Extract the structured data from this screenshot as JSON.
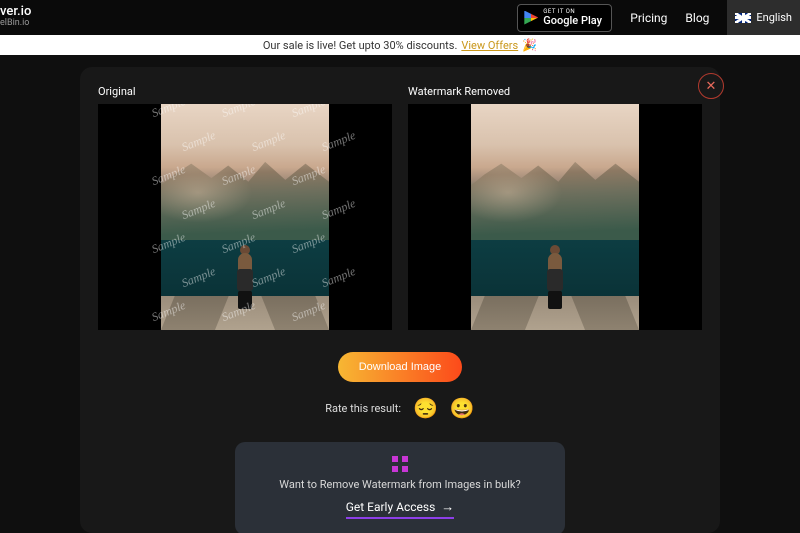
{
  "header": {
    "brand_line1": "ver.io",
    "brand_line2": "elBin.io",
    "google_play_small": "GET IT ON",
    "google_play_large": "Google Play",
    "nav_pricing": "Pricing",
    "nav_blog": "Blog",
    "lang_label": "English"
  },
  "promo": {
    "text": "Our sale is live! Get upto 30% discounts.",
    "link": "View Offers",
    "emoji": "🎉"
  },
  "compare": {
    "original_label": "Original",
    "removed_label": "Watermark Removed",
    "watermark_word": "Sample"
  },
  "actions": {
    "download": "Download Image",
    "rate_label": "Rate this result:",
    "sad": "😔",
    "happy": "😀"
  },
  "bulk": {
    "question": "Want to Remove Watermark from Images in bulk?",
    "cta": "Get Early Access",
    "arrow": "→"
  },
  "colors": {
    "accent_gradient_start": "#f7b733",
    "accent_gradient_end": "#fc4a1a",
    "close_border": "#b23a2e",
    "bulk_underline": "#8d3fe8"
  }
}
